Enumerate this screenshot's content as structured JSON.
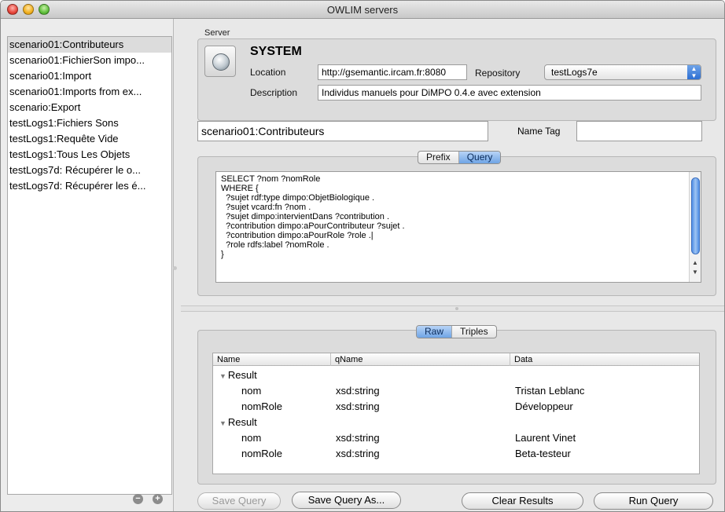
{
  "window": {
    "title": "OWLIM servers"
  },
  "sidebar": {
    "items": [
      "scenario01:Contributeurs",
      "scenario01:FichierSon impo...",
      "scenario01:Import",
      "scenario01:Imports from ex...",
      "scenario:Export",
      "testLogs1:Fichiers Sons",
      "testLogs1:Requête Vide",
      "testLogs1:Tous Les Objets",
      "testLogs7d: Récupérer le o...",
      "testLogs7d: Récupérer les é..."
    ],
    "remove_symbol": "−",
    "add_symbol": "+"
  },
  "server": {
    "section_label": "Server",
    "name": "SYSTEM",
    "location_label": "Location",
    "location_value": "http://gsemantic.ircam.fr:8080",
    "repository_label": "Repository",
    "repository_value": "testLogs7e",
    "description_label": "Description",
    "description_value": "Individus manuels pour DiMPO 0.4.e avec extension"
  },
  "query_header": {
    "name": "scenario01:Contributeurs",
    "name_tag_label": "Name Tag",
    "name_tag_value": ""
  },
  "editor": {
    "tabs": [
      "Prefix",
      "Query"
    ],
    "active_tab": "Query",
    "text": "SELECT ?nom ?nomRole\nWHERE {\n  ?sujet rdf:type dimpo:ObjetBiologique .\n  ?sujet vcard:fn ?nom .\n  ?sujet dimpo:intervientDans ?contribution .\n  ?contribution dimpo:aPourContributeur ?sujet .\n  ?contribution dimpo:aPourRole ?role .|\n  ?role rdfs:label ?nomRole .\n}"
  },
  "results": {
    "tabs": [
      "Raw",
      "Triples"
    ],
    "active_tab": "Raw",
    "columns": [
      "Name",
      "qName",
      "Data"
    ],
    "rows": [
      {
        "name": "Result",
        "qname": "",
        "data": "",
        "group": true
      },
      {
        "name": "nom",
        "qname": "xsd:string",
        "data": "Tristan Leblanc",
        "group": false
      },
      {
        "name": "nomRole",
        "qname": "xsd:string",
        "data": "Développeur",
        "group": false
      },
      {
        "name": "Result",
        "qname": "",
        "data": "",
        "group": true
      },
      {
        "name": "nom",
        "qname": "xsd:string",
        "data": "Laurent Vinet",
        "group": false
      },
      {
        "name": "nomRole",
        "qname": "xsd:string",
        "data": "Beta-testeur",
        "group": false
      }
    ]
  },
  "buttons": {
    "save_query": "Save Query",
    "save_query_as": "Save Query As...",
    "clear_results": "Clear Results",
    "run_query": "Run Query"
  },
  "colors": {
    "accent": "#6fa4e5",
    "window_bg": "#e8e8e8",
    "selected_row": "#dcdcdc"
  }
}
